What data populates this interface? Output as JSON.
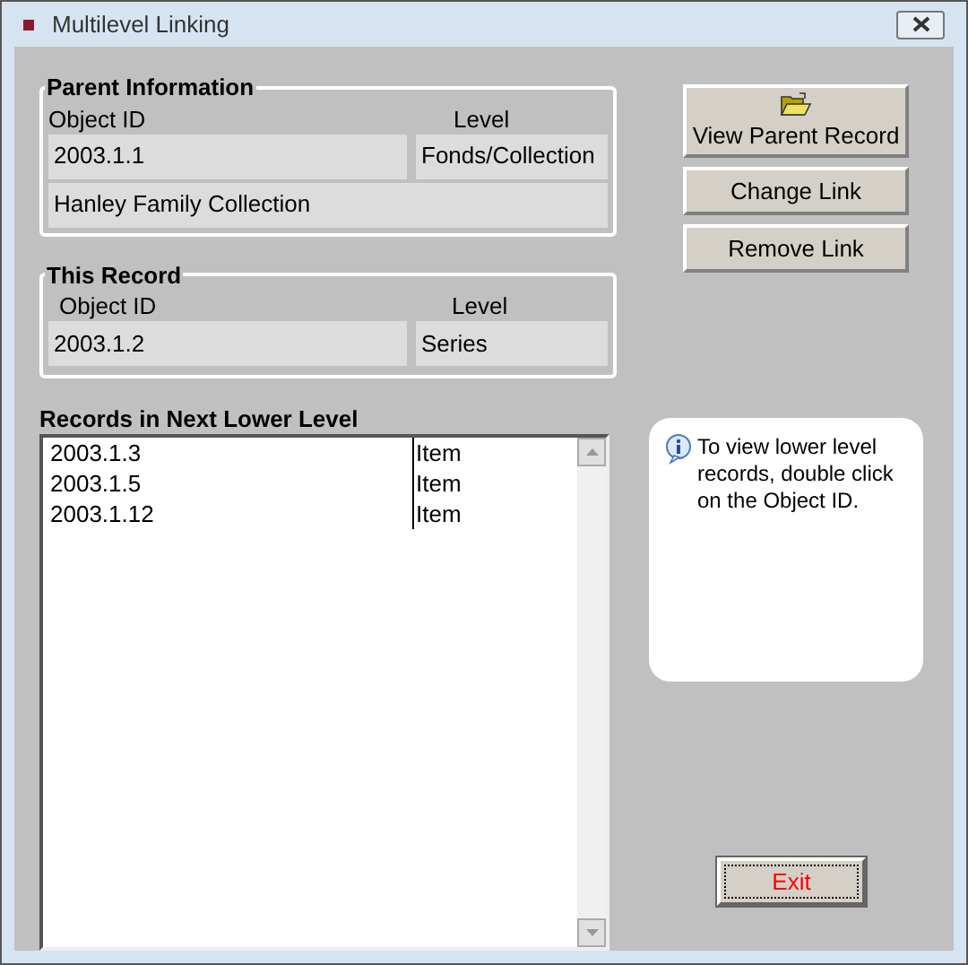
{
  "window": {
    "title": "Multilevel Linking"
  },
  "parent_information": {
    "title": "Parent Information",
    "id_header": "Object ID",
    "level_header": "Level",
    "object_id": "2003.1.1",
    "level": "Fonds/Collection",
    "name": "Hanley Family Collection"
  },
  "this_record": {
    "title": "This Record",
    "id_header": "Object ID",
    "level_header": "Level",
    "object_id": "2003.1.2",
    "level": "Series"
  },
  "lower_records": {
    "title": "Records in Next Lower Level",
    "rows": [
      {
        "object_id": "2003.1.3",
        "level": "Item"
      },
      {
        "object_id": "2003.1.5",
        "level": "Item"
      },
      {
        "object_id": "2003.1.12",
        "level": "Item"
      }
    ]
  },
  "buttons": [
    {
      "label": "View Parent Record",
      "kind": "folder"
    },
    {
      "label": "Change Link",
      "kind": "plain"
    },
    {
      "label": "Remove Link",
      "kind": "plain"
    }
  ],
  "info": "To view lower level records, double click on the Object ID.",
  "exit": {
    "label": "Exit",
    "focused": true
  }
}
